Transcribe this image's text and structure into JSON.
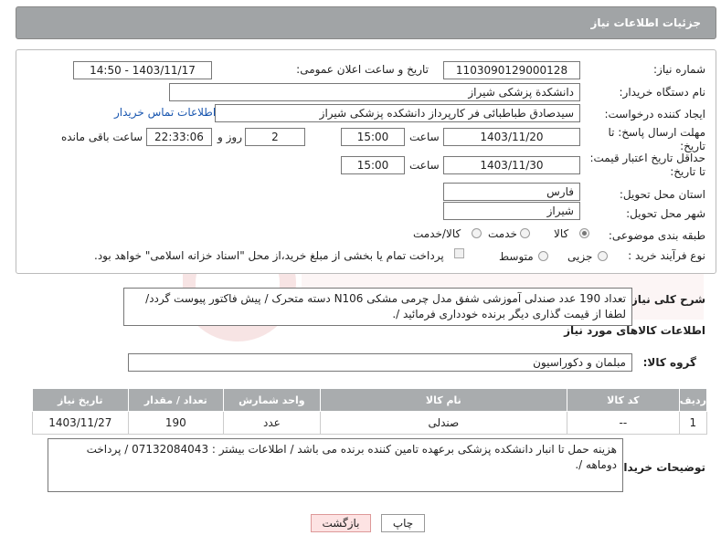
{
  "header": {
    "title": "جزئیات اطلاعات نیاز"
  },
  "fields": {
    "need_number_label": "شماره نیاز:",
    "need_number": "1103090129000128",
    "announce_label": "تاریخ و ساعت اعلان عمومی:",
    "announce_value": "1403/11/17 - 14:50",
    "buyer_org_label": "نام دستگاه خریدار:",
    "buyer_org": "دانشکدة پزشکی شیراز",
    "creator_label": "ایجاد کننده درخواست:",
    "creator": "سیدصادق طباطبائی فر کارپرداز دانشکده پزشکی شیراز",
    "contact_link": "اطلاعات تماس خریدار",
    "deadline_label": "مهلت ارسال پاسخ: تا تاریخ:",
    "deadline_date": "1403/11/20",
    "hour_word": "ساعت",
    "deadline_time": "15:00",
    "days": "2",
    "days_word": "روز و",
    "remaining_time": "22:33:06",
    "remaining_word": "ساعت باقی مانده",
    "validity_label": "حداقل تاریخ اعتبار قیمت: تا تاریخ:",
    "validity_date": "1403/11/30",
    "validity_time": "15:00",
    "province_label": "استان محل تحویل:",
    "province": "فارس",
    "city_label": "شهر محل تحویل:",
    "city": "شیراز",
    "category_label": "طبقه بندی موضوعی:",
    "category_options": [
      "کالا",
      "خدمت",
      "کالا/خدمت"
    ],
    "process_label": "نوع فرآیند خرید :",
    "process_options": [
      "جزیی",
      "متوسط"
    ],
    "payment_note": "پرداخت تمام یا بخشی از مبلغ خرید،از محل \"اسناد خزانه اسلامی\" خواهد بود."
  },
  "description": {
    "label": "شرح کلی نیاز:",
    "text": "تعداد 190 عدد صندلی آموزشی شفق مدل چرمی مشکی N106 دسته متحرک / پیش فاکتور پیوست گردد/ لطفا از قیمت گذاری دیگر برنده خودداری فرمائید /."
  },
  "goods": {
    "section_title": "اطلاعات کالاهای مورد نیاز",
    "group_label": "گروه کالا:",
    "group_value": "مبلمان و دکوراسیون",
    "columns": [
      "ردیف",
      "کد کالا",
      "نام کالا",
      "واحد شمارش",
      "تعداد / مقدار",
      "تاریخ نیاز"
    ],
    "rows": [
      {
        "row": "1",
        "code": "--",
        "name": "صندلی",
        "unit": "عدد",
        "qty": "190",
        "date": "1403/11/27"
      }
    ]
  },
  "buyer_notes": {
    "label": "توضیحات خریدار:",
    "text": "هزینه حمل تا انبار دانشکده پزشکی برعهده تامین کننده برنده می باشد / اطلاعات بیشتر : 07132084043 / پرداخت دوماهه /."
  },
  "buttons": {
    "print": "چاپ",
    "back": "بازگشت"
  },
  "colors": {
    "header_bg": "#a1a4a6",
    "link": "#1a57b0",
    "back_button_bg": "#fde3e3"
  }
}
